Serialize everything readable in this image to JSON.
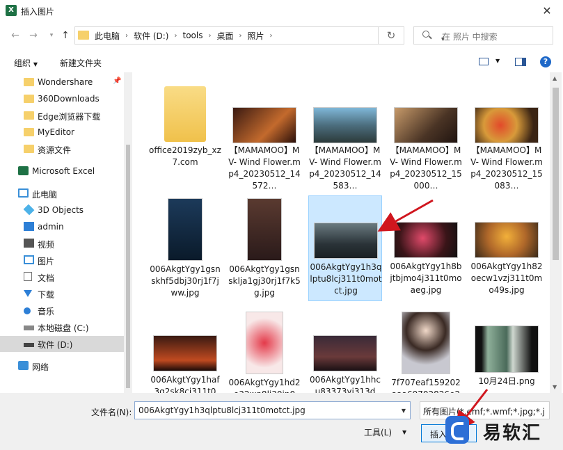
{
  "window": {
    "title": "插入图片",
    "app_icon": "excel-icon"
  },
  "address": {
    "crumbs": [
      "此电脑",
      "软件 (D:)",
      "tools",
      "桌面",
      "照片"
    ],
    "search_placeholder": "在 照片 中搜索"
  },
  "toolbar": {
    "organize": "组织",
    "new_folder": "新建文件夹"
  },
  "sidebar": {
    "quick": [
      "Wondershare",
      "360Downloads",
      "Edge浏览器下载",
      "MyEditor",
      "资源文件"
    ],
    "excel": "Microsoft Excel",
    "pc": "此电脑",
    "pc_items": [
      "3D Objects",
      "admin",
      "视频",
      "图片",
      "文档",
      "下载",
      "音乐",
      "本地磁盘 (C:)",
      "软件 (D:)"
    ],
    "network": "网络"
  },
  "files": [
    {
      "name": "office2019zyb_xz7.com",
      "type": "folder"
    },
    {
      "name": "【MAMAMOO】MV- Wind Flower.mp4_20230512_14572…",
      "type": "image"
    },
    {
      "name": "【MAMAMOO】MV- Wind Flower.mp4_20230512_14583…",
      "type": "image"
    },
    {
      "name": "【MAMAMOO】MV- Wind Flower.mp4_20230512_15000…",
      "type": "image"
    },
    {
      "name": "【MAMAMOO】MV- Wind Flower.mp4_20230512_15083…",
      "type": "image"
    },
    {
      "name": "006AkgtYgy1gsnskhf5dbj30rj1f7jww.jpg",
      "type": "image"
    },
    {
      "name": "006AkgtYgy1gsnsklja1gj30rj1f7k5g.jpg",
      "type": "image"
    },
    {
      "name": "006AkgtYgy1h3qlptu8lcj311t0motct.jpg",
      "type": "image",
      "selected": true
    },
    {
      "name": "006AkgtYgy1h8bjtbjmo4j311t0moaeg.jpg",
      "type": "image"
    },
    {
      "name": "006AkgtYgy1h82oecw1vzj311t0mo49s.jpg",
      "type": "image"
    },
    {
      "name": "006AkgtYgy1haf3g2sk8cj311t0",
      "type": "image"
    },
    {
      "name": "006AkgtYgy1hd2o32wp8lj30jp0",
      "type": "image"
    },
    {
      "name": "006AkgtYgy1hhcu83373yj313d",
      "type": "image"
    },
    {
      "name": "7f707eaf159202aaa69702826e2",
      "type": "image"
    },
    {
      "name": "10月24日.png",
      "type": "image"
    }
  ],
  "bottom": {
    "filename_label": "文件名(N):",
    "filename_value": "006AkgtYgy1h3qlptu8lcj311t0motct.jpg",
    "filetype": "所有图片(*.emf;*.wmf;*.jpg;*.j",
    "tools": "工具(L)",
    "insert": "插入"
  },
  "watermark": {
    "text": "易软汇"
  },
  "colors": {
    "selection": "#cce8ff",
    "accent": "#0078d7",
    "annotation_arrow": "#d0161e"
  }
}
